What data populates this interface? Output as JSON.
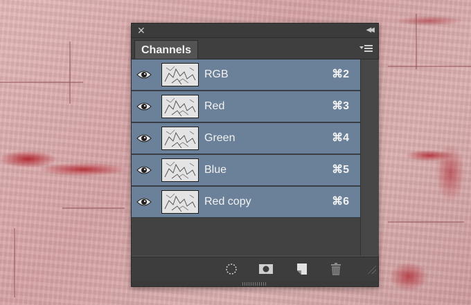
{
  "panel": {
    "tab_label": "Channels",
    "channels": [
      {
        "name": "RGB",
        "shortcut": "⌘2"
      },
      {
        "name": "Red",
        "shortcut": "⌘3"
      },
      {
        "name": "Green",
        "shortcut": "⌘4"
      },
      {
        "name": "Blue",
        "shortcut": "⌘5"
      },
      {
        "name": "Red copy",
        "shortcut": "⌘6"
      }
    ],
    "icons": {
      "close": "close-icon",
      "collapse": "collapse-icon",
      "menu": "panel-menu-icon",
      "visibility": "eye-icon",
      "load_selection": "load-channel-as-selection-icon",
      "save_selection": "save-selection-as-channel-icon",
      "new_channel": "new-channel-icon",
      "delete": "trash-icon"
    }
  },
  "colors": {
    "row_selected": "#6b8199",
    "panel_bg": "#535353"
  }
}
